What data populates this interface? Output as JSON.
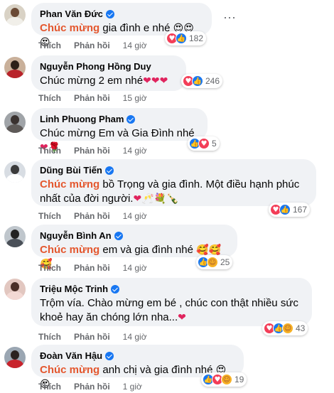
{
  "action_like": "Thích",
  "action_reply": "Phản hồi",
  "comments": [
    {
      "name": "Phan Văn Đức",
      "prefix": "Chúc mừng",
      "text": " gia đình e nhé",
      "emoji": "😍😍😍",
      "count": "182",
      "time": "14 giờ",
      "reactions": [
        "love",
        "like"
      ]
    },
    {
      "name": "Nguyễn Phong Hồng Duy",
      "prefix": "",
      "text": "Chúc mừng 2 em nhé",
      "emoji": "❤❤❤",
      "count": "246",
      "time": "15 giờ",
      "reactions": [
        "love",
        "like"
      ]
    },
    {
      "name": "Linh Phuong Pham",
      "prefix": "",
      "text": "Chúc mừng Em và Gia Đình nhé",
      "emoji": "❤🌹",
      "count": "5",
      "time": "14 giờ",
      "reactions": [
        "like",
        "love"
      ]
    },
    {
      "name": "Dũng Bùi Tiến",
      "prefix": "Chúc mừng",
      "text": " bồ Trọng và gia đình. Một điều hạnh phúc nhất của đời người.",
      "emoji": "❤🥂💐🍾",
      "count": "167",
      "time": "14 giờ",
      "reactions": [
        "love",
        "like"
      ]
    },
    {
      "name": "Nguyễn Bình An",
      "prefix": "Chúc mừng",
      "text": " em và gia đình nhé",
      "emoji": "🥰🥰🥰",
      "count": "25",
      "time": "14 giờ",
      "reactions": [
        "like",
        "care"
      ]
    },
    {
      "name": "Triệu Mộc Trinh",
      "prefix": "",
      "text": "Trộm vía. Chào mừng em bé , chúc con thật nhiều sức khoẻ hay ăn chóng lớn nha...",
      "emoji": "❤",
      "count": "43",
      "time": "14 giờ",
      "reactions": [
        "love",
        "like",
        "care"
      ]
    },
    {
      "name": "Đoàn Văn Hậu",
      "prefix": "Chúc mừng",
      "text": " anh chị và gia đình nhé",
      "emoji": "😍😍",
      "count": "19",
      "time": "1 giờ",
      "reactions": [
        "like",
        "love",
        "care"
      ]
    }
  ],
  "colors": {
    "highlight": "#e4572e",
    "like": "#1877f2",
    "love": "#f33e58",
    "care": "#f7b125"
  },
  "icons": {
    "verified": "verified-badge-icon",
    "more": "more-options-icon"
  }
}
